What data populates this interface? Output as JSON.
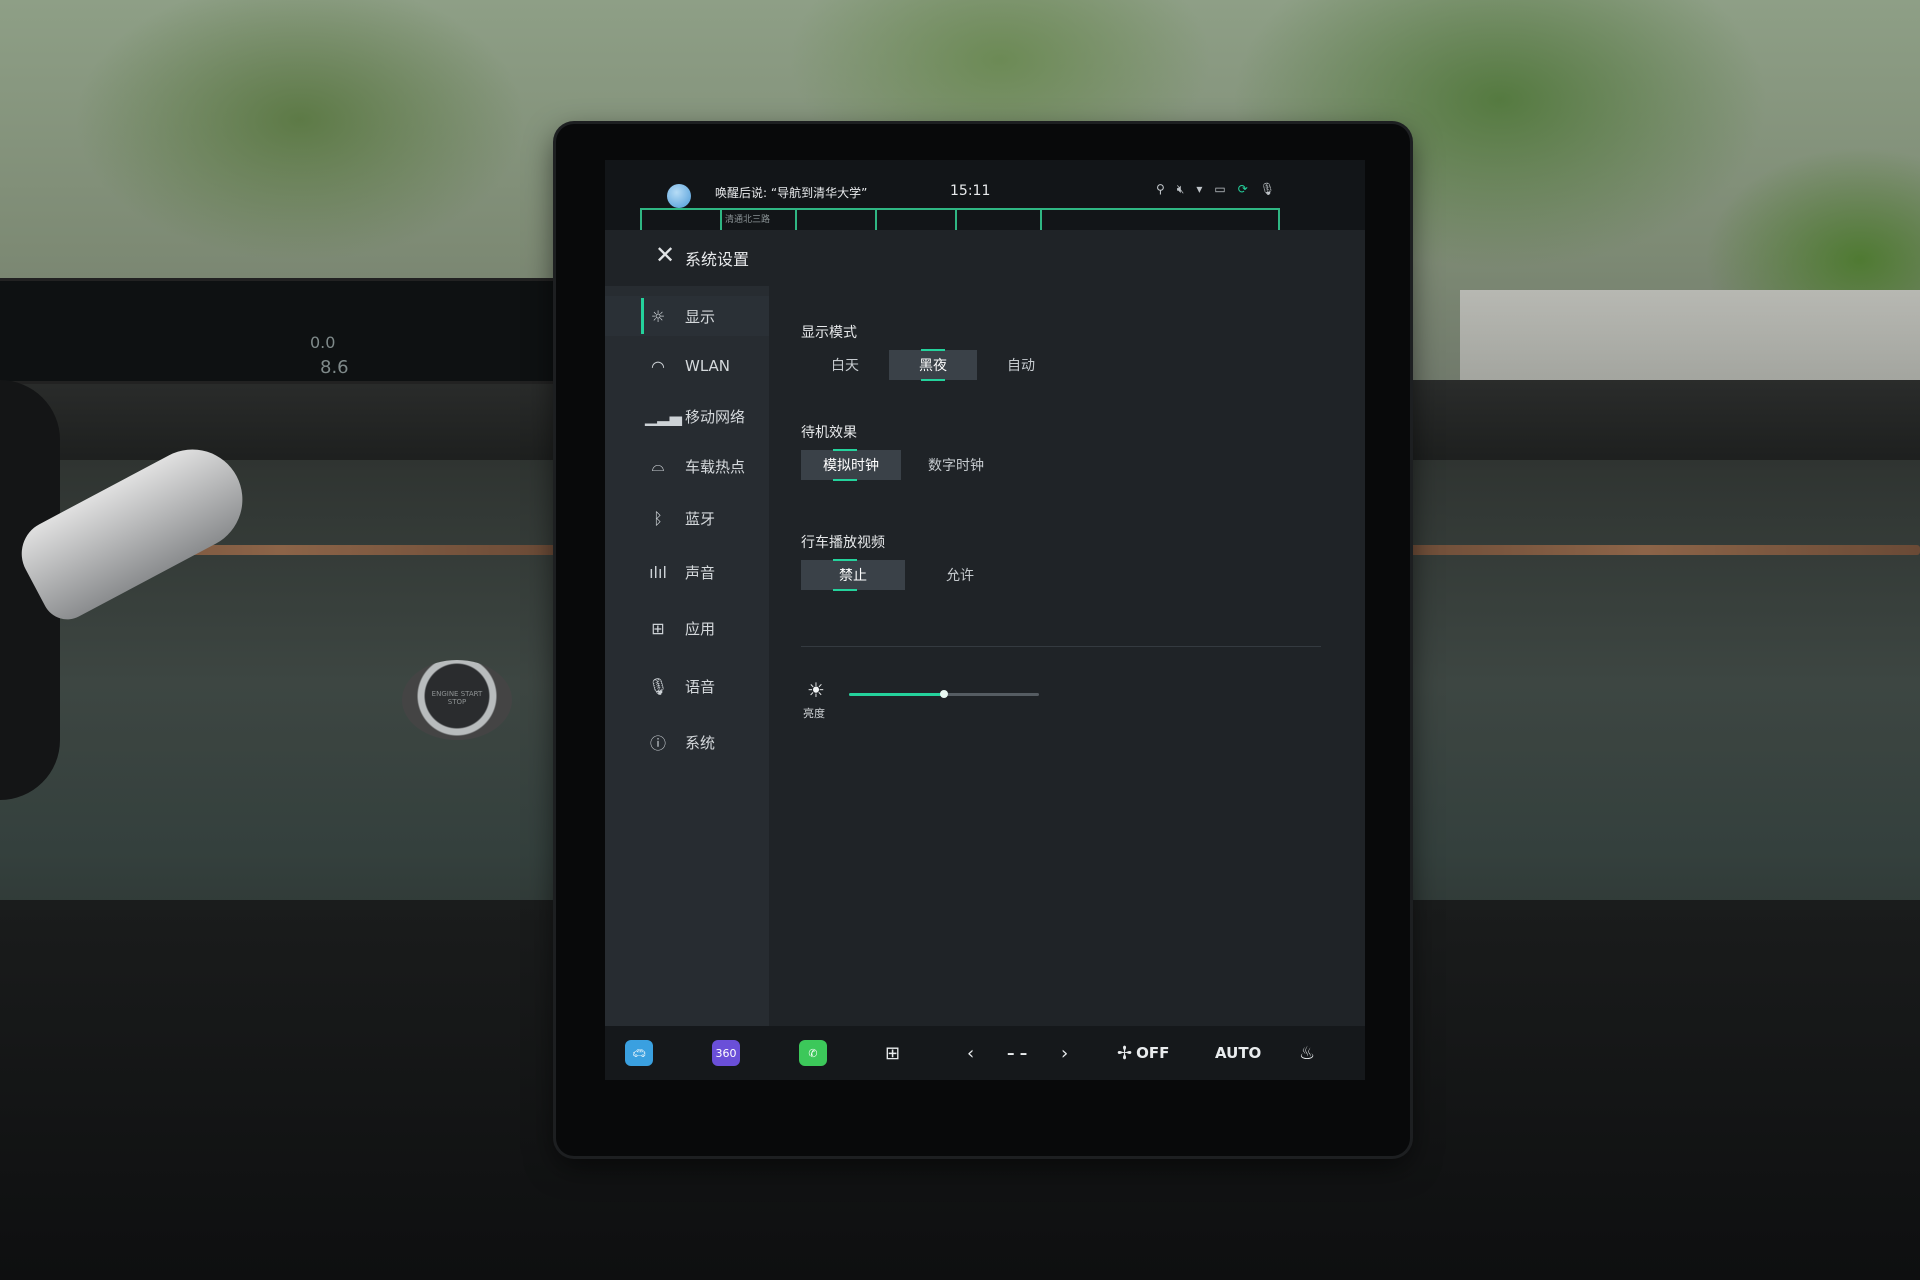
{
  "status_bar": {
    "voice_hint": "唤醒后说: “导航到清华大学”",
    "time": "15:11",
    "map_road_label": "清通北三路",
    "icons": [
      "person-icon",
      "volume-muted-icon",
      "wifi-icon",
      "camera-icon",
      "sync-icon",
      "microphone-icon"
    ]
  },
  "header": {
    "title": "系统设置"
  },
  "sidebar": {
    "items": [
      {
        "label": "显示",
        "icon": "display-brightness-icon",
        "active": true
      },
      {
        "label": "WLAN",
        "icon": "wifi-icon",
        "active": false
      },
      {
        "label": "移动网络",
        "icon": "signal-bars-icon",
        "active": false
      },
      {
        "label": "车载热点",
        "icon": "car-hotspot-icon",
        "active": false
      },
      {
        "label": "蓝牙",
        "icon": "bluetooth-icon",
        "active": false
      },
      {
        "label": "声音",
        "icon": "sound-wave-icon",
        "active": false
      },
      {
        "label": "应用",
        "icon": "apps-grid-icon",
        "active": false
      },
      {
        "label": "语音",
        "icon": "microphone-icon",
        "active": false
      },
      {
        "label": "系统",
        "icon": "info-icon",
        "active": false
      }
    ]
  },
  "display_settings": {
    "display_mode": {
      "title": "显示模式",
      "options": [
        "白天",
        "黑夜",
        "自动"
      ],
      "selected": "黑夜"
    },
    "standby_effect": {
      "title": "待机效果",
      "options": [
        "模拟时钟",
        "数字时钟"
      ],
      "selected": "模拟时钟"
    },
    "driving_video": {
      "title": "行车播放视频",
      "options": [
        "禁止",
        "允许"
      ],
      "selected": "禁止"
    },
    "brightness": {
      "label": "亮度",
      "value_fraction": 0.5
    }
  },
  "dock": {
    "app_360_label": "360",
    "fan_label": "OFF",
    "auto_label": "AUTO",
    "temp_placeholder": "– –",
    "colors": {
      "car_app": "#3aa0e0",
      "camera_360": "#6a4fd8",
      "phone": "#3cc85a",
      "accent": "#24d29c"
    }
  },
  "background": {
    "cluster_labels": [
      "0.0",
      "8.6"
    ],
    "start_button_label": "ENGINE START STOP"
  }
}
